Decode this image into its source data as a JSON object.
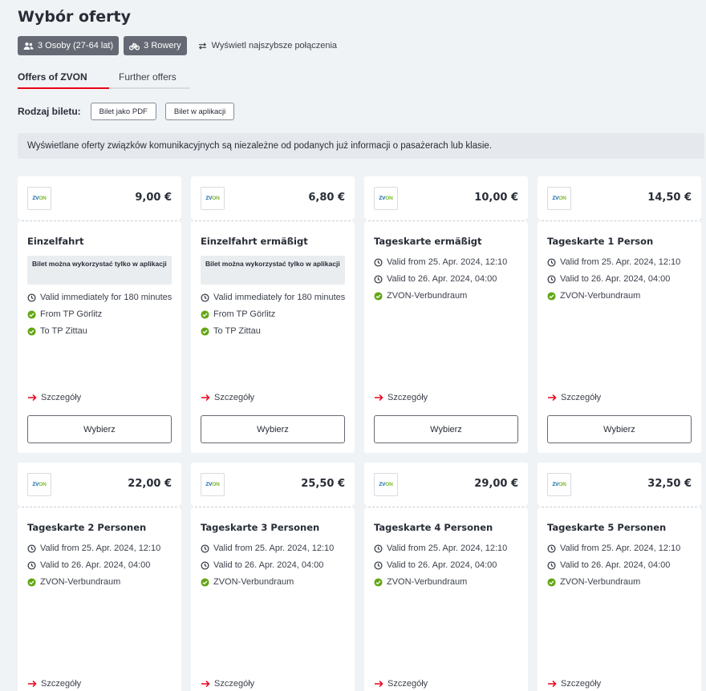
{
  "page_title": "Wybór oferty",
  "chips": {
    "persons": "3 Osoby (27-64 lat)",
    "bikes": "3 Rowery"
  },
  "fastest_link": "Wyświetl najszybsze połączenia",
  "tabs": [
    {
      "label": "Offers of ZVON",
      "active": true
    },
    {
      "label": "Further offers",
      "active": false
    }
  ],
  "ticket_type": {
    "label": "Rodzaj biletu:",
    "options": [
      "Bilet jako PDF",
      "Bilet w aplikacji"
    ]
  },
  "info_banner": "Wyświetlane oferty związków komunikacyjnych są niezależne od podanych już informacji o pasażerach lub klasie.",
  "common": {
    "logo_zv": "ZV",
    "logo_on": "ON",
    "details_label": "Szczegóły",
    "select_label": "Wybierz"
  },
  "colors": {
    "accent_red": "#ec0016",
    "check_green": "#63a615",
    "chip_bg": "#646973"
  },
  "offers": [
    {
      "price": "9,00 €",
      "name": "Einzelfahrt",
      "notice": "Bilet można wykorzystać tylko w aplikacji",
      "facts": [
        {
          "icon": "clock-icon",
          "text": "Valid immediately for 180 minutes"
        },
        {
          "icon": "check-icon",
          "text": "From TP Görlitz"
        },
        {
          "icon": "check-icon",
          "text": "To TP Zittau"
        }
      ]
    },
    {
      "price": "6,80 €",
      "name": "Einzelfahrt ermäßigt",
      "notice": "Bilet można wykorzystać tylko w aplikacji",
      "facts": [
        {
          "icon": "clock-icon",
          "text": "Valid immediately for 180 minutes"
        },
        {
          "icon": "check-icon",
          "text": "From TP Görlitz"
        },
        {
          "icon": "check-icon",
          "text": "To TP Zittau"
        }
      ]
    },
    {
      "price": "10,00 €",
      "name": "Tageskarte ermäßigt",
      "facts": [
        {
          "icon": "clock-icon",
          "text": "Valid from 25. Apr. 2024, 12:10"
        },
        {
          "icon": "clock-icon",
          "text": "Valid to 26. Apr. 2024, 04:00"
        },
        {
          "icon": "check-icon",
          "text": "ZVON-Verbundraum"
        }
      ]
    },
    {
      "price": "14,50 €",
      "name": "Tageskarte 1 Person",
      "facts": [
        {
          "icon": "clock-icon",
          "text": "Valid from 25. Apr. 2024, 12:10"
        },
        {
          "icon": "clock-icon",
          "text": "Valid to 26. Apr. 2024, 04:00"
        },
        {
          "icon": "check-icon",
          "text": "ZVON-Verbundraum"
        }
      ]
    },
    {
      "price": "22,00 €",
      "name": "Tageskarte 2 Personen",
      "facts": [
        {
          "icon": "clock-icon",
          "text": "Valid from 25. Apr. 2024, 12:10"
        },
        {
          "icon": "clock-icon",
          "text": "Valid to 26. Apr. 2024, 04:00"
        },
        {
          "icon": "check-icon",
          "text": "ZVON-Verbundraum"
        }
      ]
    },
    {
      "price": "25,50 €",
      "name": "Tageskarte 3 Personen",
      "facts": [
        {
          "icon": "clock-icon",
          "text": "Valid from 25. Apr. 2024, 12:10"
        },
        {
          "icon": "clock-icon",
          "text": "Valid to 26. Apr. 2024, 04:00"
        },
        {
          "icon": "check-icon",
          "text": "ZVON-Verbundraum"
        }
      ]
    },
    {
      "price": "29,00 €",
      "name": "Tageskarte 4 Personen",
      "facts": [
        {
          "icon": "clock-icon",
          "text": "Valid from 25. Apr. 2024, 12:10"
        },
        {
          "icon": "clock-icon",
          "text": "Valid to 26. Apr. 2024, 04:00"
        },
        {
          "icon": "check-icon",
          "text": "ZVON-Verbundraum"
        }
      ]
    },
    {
      "price": "32,50 €",
      "name": "Tageskarte 5 Personen",
      "facts": [
        {
          "icon": "clock-icon",
          "text": "Valid from 25. Apr. 2024, 12:10"
        },
        {
          "icon": "clock-icon",
          "text": "Valid to 26. Apr. 2024, 04:00"
        },
        {
          "icon": "check-icon",
          "text": "ZVON-Verbundraum"
        }
      ]
    }
  ]
}
